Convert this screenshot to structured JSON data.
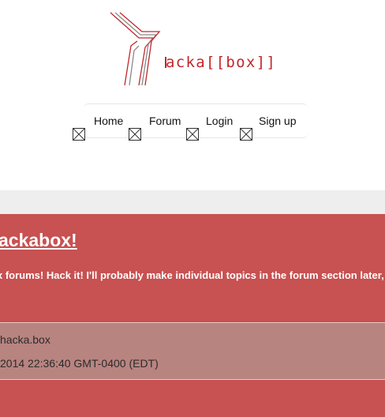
{
  "logo": {
    "text": "acka[[box]]"
  },
  "nav": {
    "items": [
      {
        "label": "Home"
      },
      {
        "label": "Forum"
      },
      {
        "label": "Login"
      },
      {
        "label": "Sign up"
      }
    ]
  },
  "post": {
    "title": "ackabox!",
    "body": "x forums! Hack it! I'll probably make individual topics in the forum section later,",
    "meta": {
      "author": "hacka.box",
      "date": "2014 22:36:40 GMT-0400 (EDT)"
    }
  }
}
